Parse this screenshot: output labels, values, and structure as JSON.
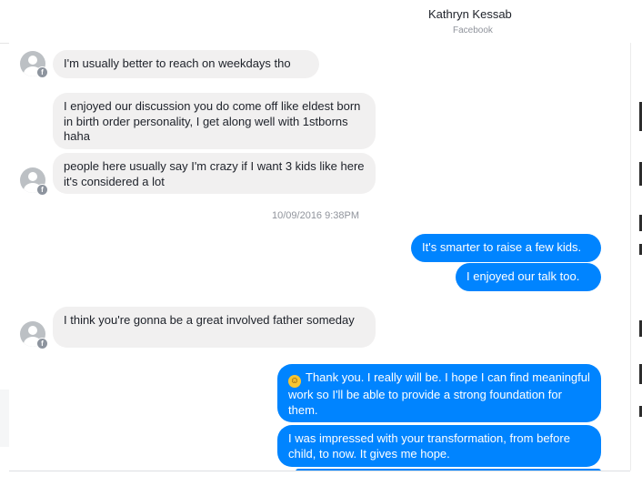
{
  "header": {
    "contact_name": "Kathryn Kessab",
    "source": "Facebook"
  },
  "icons": {
    "avatar": "default-person-avatar",
    "badge": "facebook-badge"
  },
  "colors": {
    "outgoing_bubble": "#0084ff",
    "incoming_bubble": "#f1f0f0",
    "timestamp": "#90949c"
  },
  "messages": [
    {
      "direction": "in",
      "text": "I'm usually better to reach on weekdays tho"
    },
    {
      "direction": "in",
      "text": "I enjoyed our discussion you do come off like eldest born in birth order personality, I get along well with 1stborns haha"
    },
    {
      "direction": "in",
      "text": "people here usually say I'm crazy if I want 3 kids like here it's considered a lot"
    },
    {
      "direction": "out",
      "text": "It's smarter to raise a few kids."
    },
    {
      "direction": "out",
      "text": "I enjoyed our talk too."
    },
    {
      "direction": "in",
      "text": "I think you're gonna be a great involved father someday"
    },
    {
      "direction": "out",
      "emoji": "☺",
      "text": "Thank you. I really will be. I hope I can find meaningful work so I'll be able to provide a strong foundation for them."
    },
    {
      "direction": "out",
      "text": "I was impressed with your transformation, from before child, to now. It gives me hope."
    }
  ],
  "timestamp": "10/09/2016 9:38PM"
}
